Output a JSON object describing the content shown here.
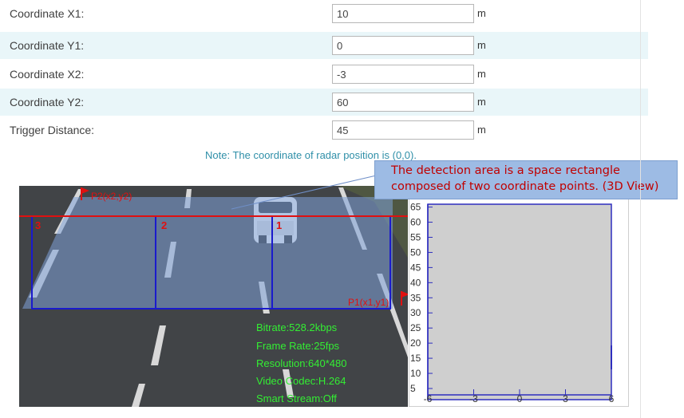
{
  "fields": [
    {
      "label": "Coordinate X1:",
      "value": "10",
      "unit": "m"
    },
    {
      "label": "Coordinate Y1:",
      "value": "0",
      "unit": "m"
    },
    {
      "label": "Coordinate X2:",
      "value": "-3",
      "unit": "m"
    },
    {
      "label": "Coordinate Y2:",
      "value": "60",
      "unit": "m"
    },
    {
      "label": "Trigger Distance:",
      "value": "45",
      "unit": "m"
    }
  ],
  "note": "Note: The coordinate of radar position is (0,0).",
  "callout": {
    "line1": "The detection area is a space rectangle",
    "line2": "composed of two coordinate points. (3D View)"
  },
  "video": {
    "markers": {
      "p2": "P2(x2,y2)",
      "p1": "P1(x1,y1)",
      "lane1": "1",
      "lane2": "2",
      "lane3": "3"
    },
    "osd": {
      "bitrate": "Bitrate:528.2kbps",
      "frame_rate": "Frame Rate:25fps",
      "resolution": "Resolution:640*480",
      "codec": "Video Codec:H.264",
      "smart_stream": "Smart Stream:Off"
    }
  },
  "radar_plot": {
    "y_ticks": [
      "5",
      "10",
      "15",
      "20",
      "25",
      "30",
      "35",
      "40",
      "45",
      "50",
      "55",
      "60",
      "65"
    ],
    "x_ticks": [
      "-6",
      "-3",
      "0",
      "3",
      "6"
    ],
    "colors": {
      "axis": "#2f2fbf",
      "plot_bg": "#cfcfcf"
    }
  },
  "colors": {
    "zebra": "#e9f6f9",
    "note": "#2f8fa8",
    "callout_bg": "#9dbbe4",
    "callout_text": "#c00000",
    "osd_text": "#33ee33",
    "zone_fill": "#7fa3d9",
    "zone_line": "#1a1acc",
    "trigger_line": "#e01010"
  }
}
